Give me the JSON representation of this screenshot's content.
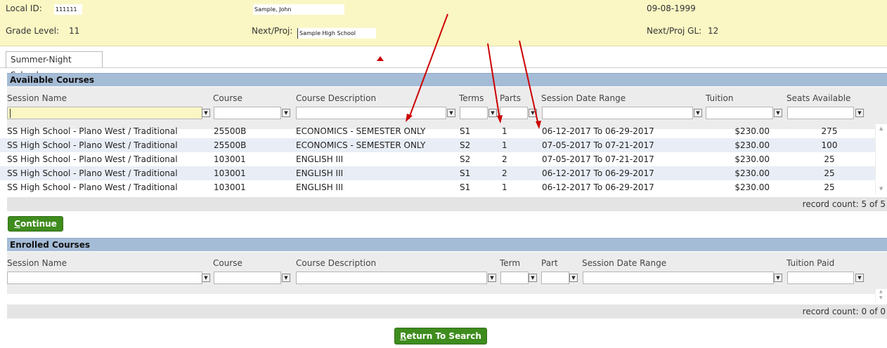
{
  "student": {
    "local_id_label": "Local ID:",
    "local_id_value": "111111",
    "name_value": "Sample, John",
    "dob_value": "09-08-1999",
    "grade_level_label": "Grade Level:",
    "grade_level_value": "11",
    "next_proj_label": "Next/Proj:",
    "next_proj_value": "Sample High School",
    "next_proj_gl_label": "Next/Proj GL:",
    "next_proj_gl_value": "12"
  },
  "tabs": [
    {
      "label": "Summer-Night School"
    }
  ],
  "available": {
    "title": "Available Courses",
    "columns": [
      "Session Name",
      "Course",
      "Course Description",
      "Terms",
      "Parts",
      "Session Date Range",
      "Tuition",
      "Seats Available"
    ],
    "rows": [
      {
        "session": "SS High School - Plano West / Traditional",
        "course": "25500B",
        "desc": "ECONOMICS - SEMESTER ONLY",
        "term": "S1",
        "part": "1",
        "range": "06-12-2017 To 06-29-2017",
        "tuition": "$230.00",
        "seats": "275"
      },
      {
        "session": "SS High School - Plano West / Traditional",
        "course": "25500B",
        "desc": "ECONOMICS - SEMESTER ONLY",
        "term": "S2",
        "part": "1",
        "range": "07-05-2017 To 07-21-2017",
        "tuition": "$230.00",
        "seats": "100"
      },
      {
        "session": "SS High School - Plano West / Traditional",
        "course": "103001",
        "desc": "ENGLISH III",
        "term": "S2",
        "part": "2",
        "range": "07-05-2017 To 07-21-2017",
        "tuition": "$230.00",
        "seats": "25"
      },
      {
        "session": "SS High School - Plano West / Traditional",
        "course": "103001",
        "desc": "ENGLISH III",
        "term": "S1",
        "part": "2",
        "range": "06-12-2017 To 06-29-2017",
        "tuition": "$230.00",
        "seats": "25"
      },
      {
        "session": "SS High School - Plano West / Traditional",
        "course": "103001",
        "desc": "ENGLISH III",
        "term": "S1",
        "part": "1",
        "range": "06-12-2017 To 06-29-2017",
        "tuition": "$230.00",
        "seats": "25"
      }
    ],
    "record_count": "record count: 5 of 5"
  },
  "continue_label_first": "C",
  "continue_label_rest": "ontinue",
  "enrolled": {
    "title": "Enrolled Courses",
    "columns": [
      "Session Name",
      "Course",
      "Course Description",
      "Term",
      "Part",
      "Session Date Range",
      "Tuition Paid"
    ],
    "record_count": "record count: 0 of 0"
  },
  "return_label_first": "R",
  "return_label_rest": "eturn To Search",
  "icons": {
    "dropdown": "dropdown-arrow-icon",
    "scroll_up": "scroll-up-icon",
    "scroll_down": "scroll-down-icon"
  },
  "colors": {
    "info_bg": "#fbf7c4",
    "section_header": "#a5bcd6",
    "button_green": "#3f8c1e",
    "annotation_arrow": "#cc0000"
  }
}
